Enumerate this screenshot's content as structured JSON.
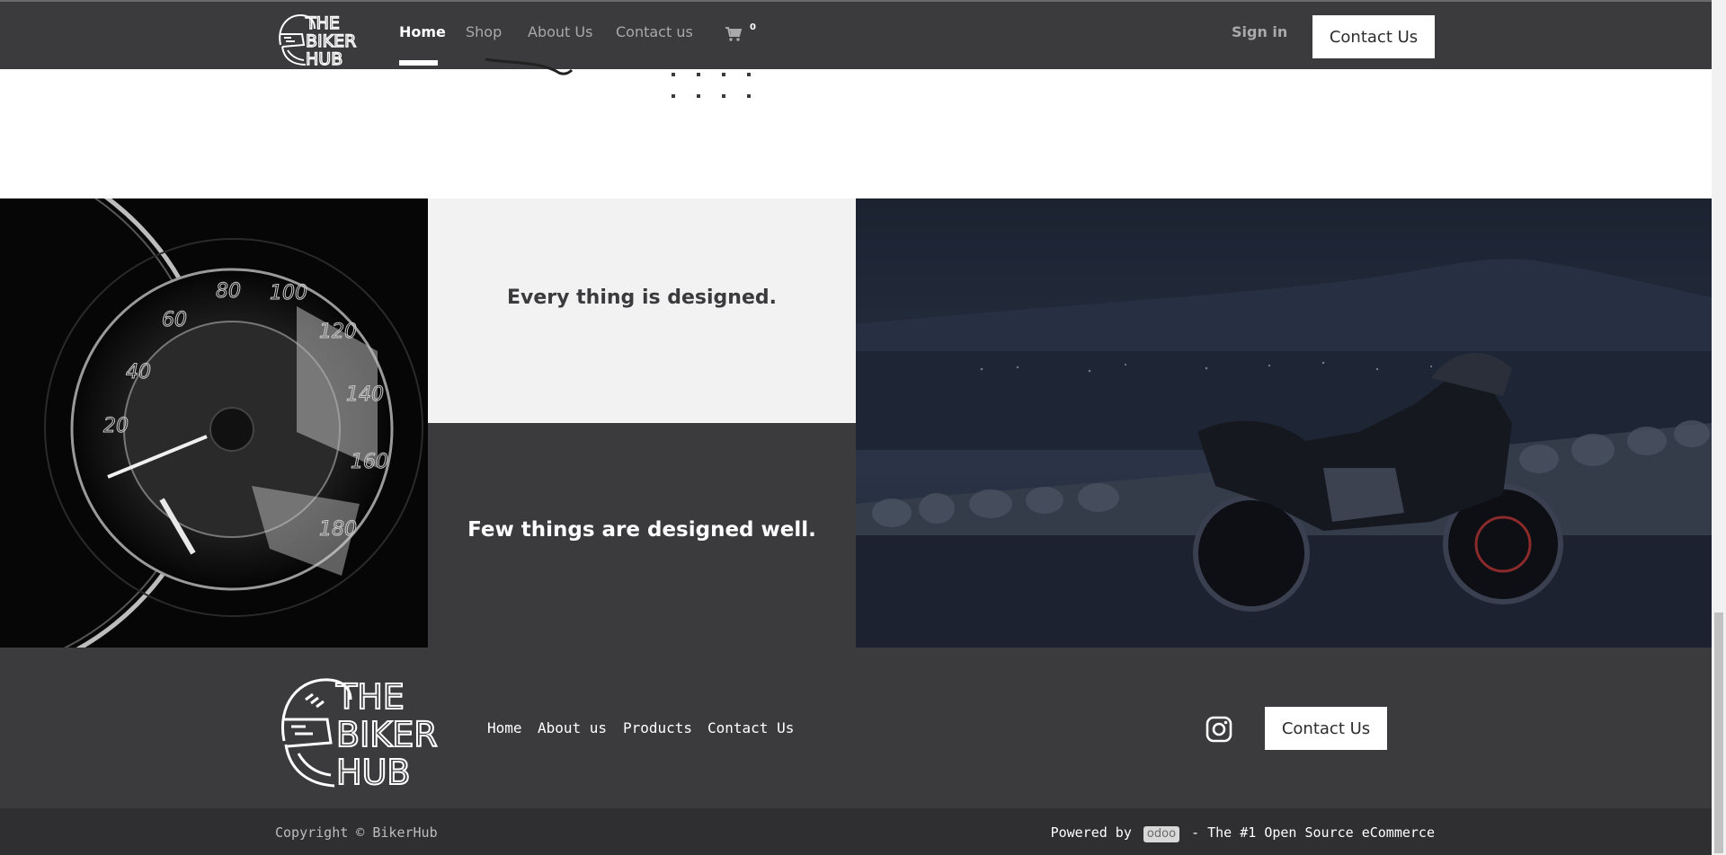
{
  "header": {
    "logo_lines": [
      "THE",
      "BIKER",
      "HUB"
    ],
    "nav": [
      {
        "label": "Home",
        "active": true
      },
      {
        "label": "Shop",
        "active": false
      },
      {
        "label": "About Us",
        "active": false
      },
      {
        "label": "Contact us",
        "active": false
      }
    ],
    "cart_icon": "cart-icon",
    "cart_count": "0",
    "sign_in": "Sign in",
    "contact_button": "Contact Us"
  },
  "feature": {
    "top_text": "Every thing is designed.",
    "bottom_text": "Few things are designed well.",
    "left_image": "speedometer-image",
    "right_image": "motorcycle-night-image"
  },
  "footer": {
    "logo_lines": [
      "THE",
      "BIKER",
      "HUB"
    ],
    "links": [
      "Home",
      "About us",
      "Products",
      "Contact Us"
    ],
    "social_icon": "instagram-icon",
    "contact_button": "Contact Us",
    "copyright": "Copyright © BikerHub",
    "powered_prefix": "Powered by",
    "powered_brand": "odoo",
    "powered_suffix": "- The #1 Open Source eCommerce"
  },
  "colors": {
    "dark": "#3b3a3c",
    "light_panel": "#f2f2f2",
    "copyright_bar": "#2f2e30",
    "white": "#ffffff"
  }
}
